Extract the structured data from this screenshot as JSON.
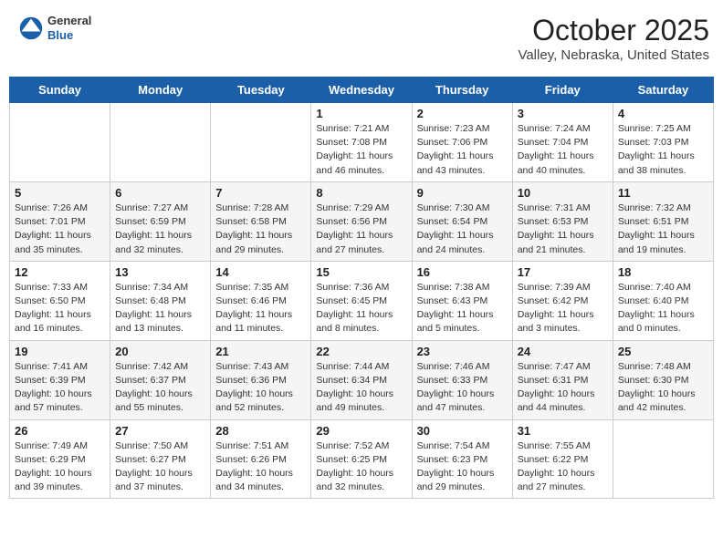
{
  "header": {
    "logo_general": "General",
    "logo_blue": "Blue",
    "month_title": "October 2025",
    "location": "Valley, Nebraska, United States"
  },
  "weekdays": [
    "Sunday",
    "Monday",
    "Tuesday",
    "Wednesday",
    "Thursday",
    "Friday",
    "Saturday"
  ],
  "weeks": [
    {
      "row_class": "data-row-odd",
      "days": [
        {
          "number": "",
          "info": ""
        },
        {
          "number": "",
          "info": ""
        },
        {
          "number": "",
          "info": ""
        },
        {
          "number": "1",
          "info": "Sunrise: 7:21 AM\nSunset: 7:08 PM\nDaylight: 11 hours\nand 46 minutes."
        },
        {
          "number": "2",
          "info": "Sunrise: 7:23 AM\nSunset: 7:06 PM\nDaylight: 11 hours\nand 43 minutes."
        },
        {
          "number": "3",
          "info": "Sunrise: 7:24 AM\nSunset: 7:04 PM\nDaylight: 11 hours\nand 40 minutes."
        },
        {
          "number": "4",
          "info": "Sunrise: 7:25 AM\nSunset: 7:03 PM\nDaylight: 11 hours\nand 38 minutes."
        }
      ]
    },
    {
      "row_class": "data-row-even",
      "days": [
        {
          "number": "5",
          "info": "Sunrise: 7:26 AM\nSunset: 7:01 PM\nDaylight: 11 hours\nand 35 minutes."
        },
        {
          "number": "6",
          "info": "Sunrise: 7:27 AM\nSunset: 6:59 PM\nDaylight: 11 hours\nand 32 minutes."
        },
        {
          "number": "7",
          "info": "Sunrise: 7:28 AM\nSunset: 6:58 PM\nDaylight: 11 hours\nand 29 minutes."
        },
        {
          "number": "8",
          "info": "Sunrise: 7:29 AM\nSunset: 6:56 PM\nDaylight: 11 hours\nand 27 minutes."
        },
        {
          "number": "9",
          "info": "Sunrise: 7:30 AM\nSunset: 6:54 PM\nDaylight: 11 hours\nand 24 minutes."
        },
        {
          "number": "10",
          "info": "Sunrise: 7:31 AM\nSunset: 6:53 PM\nDaylight: 11 hours\nand 21 minutes."
        },
        {
          "number": "11",
          "info": "Sunrise: 7:32 AM\nSunset: 6:51 PM\nDaylight: 11 hours\nand 19 minutes."
        }
      ]
    },
    {
      "row_class": "data-row-odd",
      "days": [
        {
          "number": "12",
          "info": "Sunrise: 7:33 AM\nSunset: 6:50 PM\nDaylight: 11 hours\nand 16 minutes."
        },
        {
          "number": "13",
          "info": "Sunrise: 7:34 AM\nSunset: 6:48 PM\nDaylight: 11 hours\nand 13 minutes."
        },
        {
          "number": "14",
          "info": "Sunrise: 7:35 AM\nSunset: 6:46 PM\nDaylight: 11 hours\nand 11 minutes."
        },
        {
          "number": "15",
          "info": "Sunrise: 7:36 AM\nSunset: 6:45 PM\nDaylight: 11 hours\nand 8 minutes."
        },
        {
          "number": "16",
          "info": "Sunrise: 7:38 AM\nSunset: 6:43 PM\nDaylight: 11 hours\nand 5 minutes."
        },
        {
          "number": "17",
          "info": "Sunrise: 7:39 AM\nSunset: 6:42 PM\nDaylight: 11 hours\nand 3 minutes."
        },
        {
          "number": "18",
          "info": "Sunrise: 7:40 AM\nSunset: 6:40 PM\nDaylight: 11 hours\nand 0 minutes."
        }
      ]
    },
    {
      "row_class": "data-row-even",
      "days": [
        {
          "number": "19",
          "info": "Sunrise: 7:41 AM\nSunset: 6:39 PM\nDaylight: 10 hours\nand 57 minutes."
        },
        {
          "number": "20",
          "info": "Sunrise: 7:42 AM\nSunset: 6:37 PM\nDaylight: 10 hours\nand 55 minutes."
        },
        {
          "number": "21",
          "info": "Sunrise: 7:43 AM\nSunset: 6:36 PM\nDaylight: 10 hours\nand 52 minutes."
        },
        {
          "number": "22",
          "info": "Sunrise: 7:44 AM\nSunset: 6:34 PM\nDaylight: 10 hours\nand 49 minutes."
        },
        {
          "number": "23",
          "info": "Sunrise: 7:46 AM\nSunset: 6:33 PM\nDaylight: 10 hours\nand 47 minutes."
        },
        {
          "number": "24",
          "info": "Sunrise: 7:47 AM\nSunset: 6:31 PM\nDaylight: 10 hours\nand 44 minutes."
        },
        {
          "number": "25",
          "info": "Sunrise: 7:48 AM\nSunset: 6:30 PM\nDaylight: 10 hours\nand 42 minutes."
        }
      ]
    },
    {
      "row_class": "data-row-odd",
      "days": [
        {
          "number": "26",
          "info": "Sunrise: 7:49 AM\nSunset: 6:29 PM\nDaylight: 10 hours\nand 39 minutes."
        },
        {
          "number": "27",
          "info": "Sunrise: 7:50 AM\nSunset: 6:27 PM\nDaylight: 10 hours\nand 37 minutes."
        },
        {
          "number": "28",
          "info": "Sunrise: 7:51 AM\nSunset: 6:26 PM\nDaylight: 10 hours\nand 34 minutes."
        },
        {
          "number": "29",
          "info": "Sunrise: 7:52 AM\nSunset: 6:25 PM\nDaylight: 10 hours\nand 32 minutes."
        },
        {
          "number": "30",
          "info": "Sunrise: 7:54 AM\nSunset: 6:23 PM\nDaylight: 10 hours\nand 29 minutes."
        },
        {
          "number": "31",
          "info": "Sunrise: 7:55 AM\nSunset: 6:22 PM\nDaylight: 10 hours\nand 27 minutes."
        },
        {
          "number": "",
          "info": ""
        }
      ]
    }
  ]
}
